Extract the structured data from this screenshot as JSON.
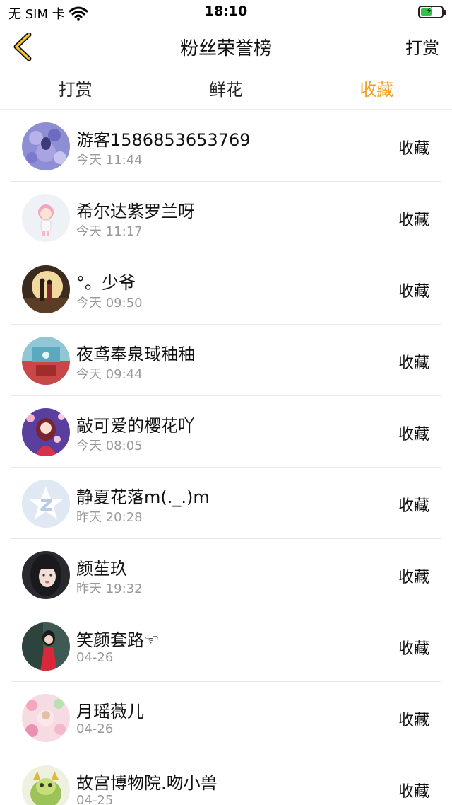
{
  "status_bar": {
    "carrier": "无 SIM 卡",
    "time": "18:10",
    "battery_level": 0.55
  },
  "nav": {
    "title": "粉丝荣誉榜",
    "action": "打赏"
  },
  "tabs": [
    {
      "label": "打赏"
    },
    {
      "label": "鲜花"
    },
    {
      "label": "收藏"
    }
  ],
  "active_tab_color": "#f0a020",
  "list": [
    {
      "name": "游客1586853653769",
      "time": "今天 11:44",
      "action": "收藏",
      "avatar": "purple-flower-avatar"
    },
    {
      "name": "希尔达紫罗兰呀",
      "time": "今天 11:17",
      "action": "收藏",
      "avatar": "pink-chibi-avatar"
    },
    {
      "name": "°。少爷",
      "time": "今天 09:50",
      "action": "收藏",
      "avatar": "couple-scene-avatar"
    },
    {
      "name": "夜鸢奉泉琙秞秞",
      "time": "今天 09:44",
      "action": "收藏",
      "avatar": "red-room-avatar"
    },
    {
      "name": "敲可爱的樱花吖",
      "time": "今天 08:05",
      "action": "收藏",
      "avatar": "anime-girl-avatar"
    },
    {
      "name": "静夏花落m(._.)m",
      "time": "昨天 20:28",
      "action": "收藏",
      "avatar": "default-qq-avatar"
    },
    {
      "name": "颜苼玖",
      "time": "昨天 19:32",
      "action": "收藏",
      "avatar": "dark-hair-girl-avatar"
    },
    {
      "name": "笑颜套路☜",
      "time": "04-26",
      "action": "收藏",
      "avatar": "red-dress-girl-avatar"
    },
    {
      "name": "月瑶薇儿",
      "time": "04-26",
      "action": "收藏",
      "avatar": "pink-floral-avatar"
    },
    {
      "name": "故宫博物院.吻小兽",
      "time": "04-25",
      "action": "收藏",
      "avatar": "green-dragon-avatar"
    }
  ]
}
